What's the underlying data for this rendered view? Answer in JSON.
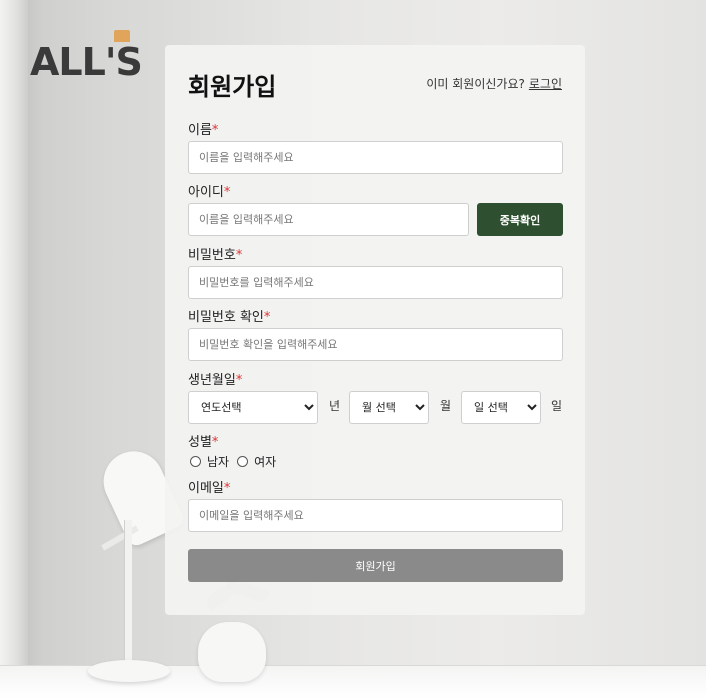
{
  "logo": {
    "text": "ALL'S",
    "accent_color": "#e0a45a"
  },
  "form": {
    "title": "회원가입",
    "login_hint": "이미 회원이신가요?",
    "login_link": "로그인",
    "required_mark": "*",
    "required_color": "#d33333",
    "name": {
      "label": "이름",
      "placeholder": "이름을 입력해주세요"
    },
    "user_id": {
      "label": "아이디",
      "placeholder": "이름을 입력해주세요",
      "check_button": "중복확인"
    },
    "password": {
      "label": "비밀번호",
      "placeholder": "비밀번호를 입력해주세요"
    },
    "password_confirm": {
      "label": "비밀번호 확인",
      "placeholder": "비밀번호 확인을 입력해주세요"
    },
    "birth": {
      "label": "생년월일",
      "year_select": "연도선택",
      "year_unit": "년",
      "month_select": "월 선택",
      "month_unit": "월",
      "day_select": "일 선택",
      "day_unit": "일"
    },
    "gender": {
      "label": "성별",
      "male": "남자",
      "female": "여자"
    },
    "email": {
      "label": "이메일",
      "placeholder": "이메일을 입력해주세요"
    },
    "submit_label": "회원가입",
    "check_button_color": "#2f5030",
    "submit_color": "#8a8a8a"
  }
}
